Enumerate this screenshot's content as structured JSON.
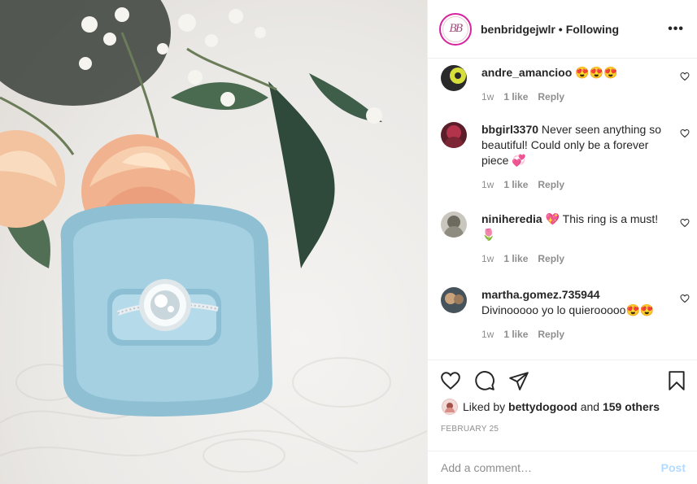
{
  "header": {
    "avatar_monogram": "BB",
    "username": "benbridgejwlr",
    "separator": "•",
    "follow_status": "Following",
    "more_label": "•••"
  },
  "comments": [
    {
      "username": "andre_amancioo",
      "text": "😍😍😍",
      "age": "1w",
      "likes": "1 like",
      "reply": "Reply",
      "avatar_color": "#c9d23a"
    },
    {
      "username": "bbgirl3370",
      "text": "Never seen anything so beautiful! Could only be a forever piece 💞",
      "age": "1w",
      "likes": "1 like",
      "reply": "Reply",
      "avatar_color": "#9a2b3c"
    },
    {
      "username": "niniheredia",
      "text": "💖 This ring is a must! 🌷",
      "age": "1w",
      "likes": "1 like",
      "reply": "Reply",
      "avatar_color": "#8a8a7c"
    },
    {
      "username": "martha.gomez.735944",
      "text": "Divinooooo yo lo quierooooo😍😍",
      "age": "1w",
      "likes": "1 like",
      "reply": "Reply",
      "avatar_color": "#5b6a73"
    }
  ],
  "actions": {
    "like_icon": "heart-icon",
    "comment_icon": "comment-icon",
    "share_icon": "share-icon",
    "save_icon": "bookmark-icon"
  },
  "likes": {
    "prefix": "Liked by",
    "user": "bettydogood",
    "conjunction": "and",
    "others": "159 others"
  },
  "date": "FEBRUARY 25",
  "add_comment": {
    "placeholder": "Add a comment…",
    "post_label": "Post"
  },
  "colors": {
    "text": "#262626",
    "muted": "#8e8e8e",
    "post_disabled": "#b3dbff",
    "ring_box": "#9cc6d8"
  }
}
